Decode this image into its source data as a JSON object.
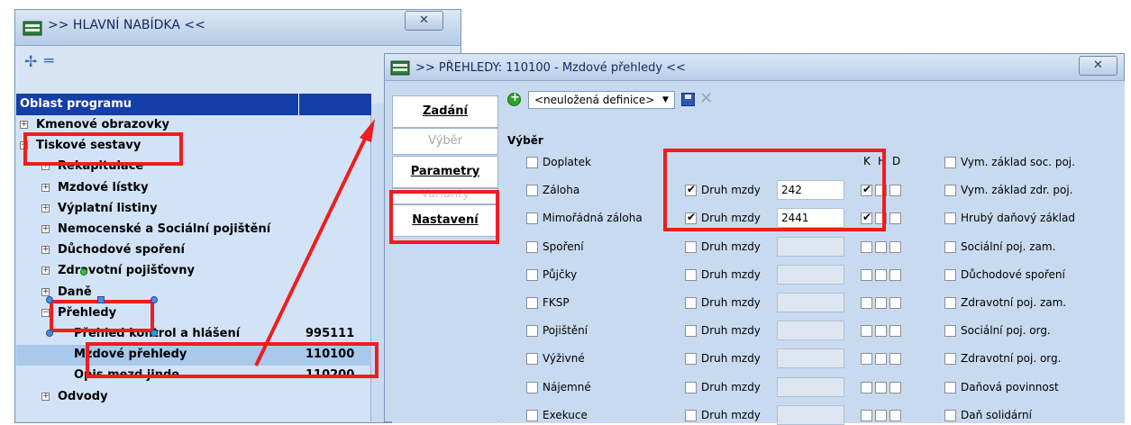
{
  "main_window": {
    "title": ">> HLAVNÍ NABÍDKA <<",
    "close": "✕",
    "tree_header": "Oblast programu",
    "tree_rows": [
      {
        "expander": "+",
        "label": "Kmenové obrazovky",
        "code": ""
      },
      {
        "expander": "−",
        "label": "Tiskové sestavy",
        "code": ""
      },
      {
        "expander": "+",
        "label": "Rekapitulace",
        "code": ""
      },
      {
        "expander": "+",
        "label": "Mzdové lístky",
        "code": ""
      },
      {
        "expander": "+",
        "label": "Výplatní listiny",
        "code": ""
      },
      {
        "expander": "+",
        "label": "Nemocenské a Sociální pojištění",
        "code": ""
      },
      {
        "expander": "+",
        "label": "Důchodové spoření",
        "code": ""
      },
      {
        "expander": "+",
        "label": "Zdravotní pojišťovny",
        "code": ""
      },
      {
        "expander": "+",
        "label": "Daně",
        "code": ""
      },
      {
        "expander": "−",
        "label": "Přehledy",
        "code": ""
      },
      {
        "expander": "",
        "label": "Přehled kontrol a hlášení",
        "code": "995111"
      },
      {
        "expander": "",
        "label": "Mzdové přehledy",
        "code": "110100"
      },
      {
        "expander": "",
        "label": "Opis mezd jinde",
        "code": "110200"
      },
      {
        "expander": "+",
        "label": "Odvody",
        "code": ""
      }
    ]
  },
  "dialog": {
    "title": ">> PŘEHLEDY: 110100 - Mzdové přehledy <<",
    "close": "✕",
    "tabs": [
      "Zadání",
      "Výběr",
      "Parametry",
      "Varianty",
      "Nastavení"
    ],
    "definition": "<neuložená definice>",
    "section_label": "Výběr",
    "column_headers": {
      "k": "K",
      "h": "H",
      "d": "D"
    },
    "druh_mzdy_label": "Druh mzdy",
    "left_items": [
      {
        "label": "Doplatek",
        "checked": false
      },
      {
        "label": "Záloha",
        "checked": false
      },
      {
        "label": "Mimořádná záloha",
        "checked": false
      },
      {
        "label": "Spoření",
        "checked": false
      },
      {
        "label": "Půjčky",
        "checked": false
      },
      {
        "label": "FKSP",
        "checked": false
      },
      {
        "label": "Pojištění",
        "checked": false
      },
      {
        "label": "Výživné",
        "checked": false
      },
      {
        "label": "Nájemné",
        "checked": false
      },
      {
        "label": "Exekuce",
        "checked": false
      }
    ],
    "druh_rows": [
      {
        "checked": true,
        "value": "242",
        "k": true
      },
      {
        "checked": true,
        "value": "2441",
        "k": true
      },
      {
        "checked": false,
        "value": "",
        "k": false
      },
      {
        "checked": false,
        "value": "",
        "k": false
      },
      {
        "checked": false,
        "value": "",
        "k": false
      },
      {
        "checked": false,
        "value": "",
        "k": false
      },
      {
        "checked": false,
        "value": "",
        "k": false
      },
      {
        "checked": false,
        "value": "",
        "k": false
      },
      {
        "checked": false,
        "value": "",
        "k": false
      }
    ],
    "right_items": [
      "Vym. základ soc. poj.",
      "Vym. základ zdr. poj.",
      "Hrubý daňový základ",
      "Sociální poj. zam.",
      "Důchodové spoření",
      "Zdravotní poj. zam.",
      "Sociální poj. org.",
      "Zdravotní poj. org.",
      "Daňová povinnost",
      "Daň solidární"
    ]
  },
  "colors": {
    "annotation": "#ef1d1d",
    "tree_header": "#143ea8",
    "selection": "#a9c8ec"
  }
}
